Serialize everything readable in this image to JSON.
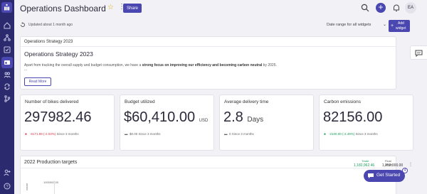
{
  "header": {
    "title": "Operations Dashboard",
    "share_label": "Share",
    "avatar_initials": "EA"
  },
  "subbar": {
    "updated": "Updated about 1 month ago",
    "date_range": "Date range for all widgets",
    "add_widget_line1": "Add",
    "add_widget_line2": "widget"
  },
  "strategy": {
    "widget_title": "Operations Strategy 2023",
    "heading": "Operations Strategy 2023",
    "body_pre": "Apart from tracking the overall supply and budget consumption, we have a ",
    "body_bold": "strong focus on improving our efficiency and becoming carbon neutral",
    "body_post": " by 2025.",
    "ellipsis": "...",
    "read_more": "Read More"
  },
  "kpis": [
    {
      "title": "Number of bikes delivered",
      "value": "297982.46",
      "unit": "",
      "delta": "-6171.89 (-2.03%)",
      "period": "Since 3 months",
      "trend": "down"
    },
    {
      "title": "Budget utilized",
      "value": "$60,410.00",
      "unit": "USD",
      "delta": "$0.00",
      "period": "Since 3 months",
      "trend": "flat"
    },
    {
      "title": "Average delivery time",
      "value": "2.8",
      "unit": "Days",
      "delta": "0",
      "period": "Since 3 months",
      "trend": "flat"
    },
    {
      "title": "Carbon emissions",
      "value": "82156.00",
      "unit": "",
      "delta": "-2100.00 (-2.49%)",
      "period": "Since 3 months",
      "trend": "up"
    }
  ],
  "production": {
    "title": "2022 Production targets",
    "trade_label": "Trade",
    "trade_value": "1,182,962.46",
    "final_label": "Final target",
    "final_value": "1,250,000.00",
    "ytick_top": "1000000.00",
    "ylabel": "count"
  },
  "get_started": {
    "label": "Get Started",
    "badge": "4"
  },
  "colors": {
    "accent": "#4a47b0",
    "sidebar": "#2c2a6e",
    "negative": "#d2374b",
    "positive": "#1a9a5a"
  },
  "icons": [
    "logo-icon",
    "home-icon",
    "network-icon",
    "checklist-icon",
    "dashboard-icon",
    "users-icon",
    "sync-icon",
    "branch-icon",
    "user-add-icon",
    "help-icon",
    "search-icon",
    "plus-icon",
    "bell-icon",
    "star-icon",
    "refresh-icon",
    "comment-icon",
    "chat-icon"
  ]
}
